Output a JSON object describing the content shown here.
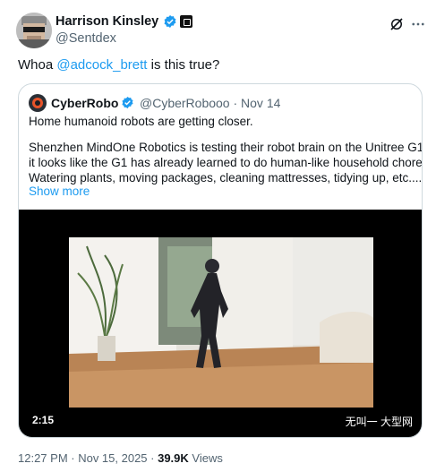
{
  "author": {
    "name": "Harrison Kinsley",
    "handle": "@Sentdex"
  },
  "tweet": {
    "prefix": "Whoa ",
    "mention": "@adcock_brett",
    "suffix": " is this true?"
  },
  "quote": {
    "name": "CyberRobo",
    "handle_date": "@CyberRobooo · Nov 14",
    "lines": [
      "Home humanoid robots are getting closer.",
      "Shenzhen MindOne Robotics is testing their robot brain on the Unitree G1, and",
      "it looks like the G1 has already learned to do human-like household  chores.",
      "Watering plants, moving packages, cleaning mattresses, tidying up, etc...."
    ],
    "show_more": "Show more",
    "video": {
      "duration": "2:15",
      "subtitle": "无叫一 大型网"
    }
  },
  "footer": {
    "time_date": "12:27 PM · Nov 15, 2025 · ",
    "views_count": "39.9K",
    "views_label": " Views"
  },
  "colors": {
    "link": "#1d9bf0",
    "secondary_text": "#536471",
    "border": "#cfd9de"
  },
  "icons": [
    "verified-badge-icon",
    "affiliate-badge-icon",
    "grok-icon",
    "more-icon"
  ]
}
